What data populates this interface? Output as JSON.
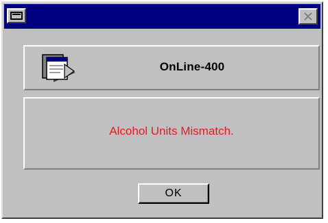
{
  "titlebar": {
    "system_menu_icon": "window-icon",
    "close_icon": "close-icon",
    "color": "#000080"
  },
  "header": {
    "app_icon": "application-window-icon",
    "title": "OnLine-400"
  },
  "message": {
    "text": "Alcohol Units Mismatch.",
    "color": "#e8191e"
  },
  "buttons": {
    "ok_label": "OK"
  }
}
